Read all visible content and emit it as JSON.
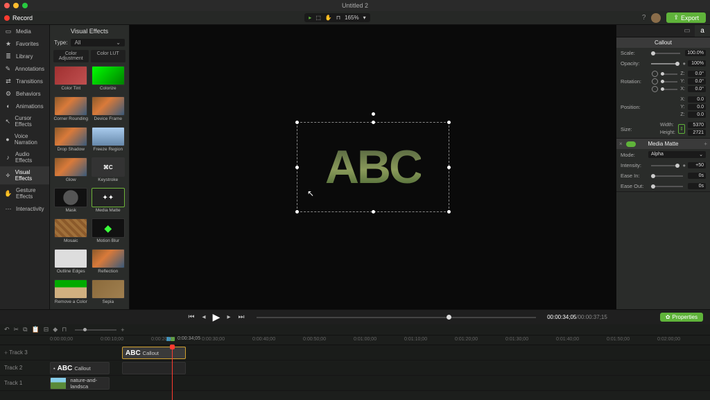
{
  "titlebar": {
    "title": "Untitled 2"
  },
  "toolbar": {
    "record": "Record",
    "zoom": "165%",
    "export": "Export"
  },
  "sidebar": {
    "items": [
      {
        "icon": "▭",
        "label": "Media"
      },
      {
        "icon": "★",
        "label": "Favorites"
      },
      {
        "icon": "≣",
        "label": "Library"
      },
      {
        "icon": "✎",
        "label": "Annotations"
      },
      {
        "icon": "⇄",
        "label": "Transitions"
      },
      {
        "icon": "⚙",
        "label": "Behaviors"
      },
      {
        "icon": "◐",
        "label": "Animations"
      },
      {
        "icon": "↖",
        "label": "Cursor Effects"
      },
      {
        "icon": "🎤",
        "label": "Voice Narration"
      },
      {
        "icon": "♪",
        "label": "Audio Effects"
      },
      {
        "icon": "✧",
        "label": "Visual Effects"
      },
      {
        "icon": "✋",
        "label": "Gesture Effects"
      },
      {
        "icon": "⋯",
        "label": "Interactivity"
      }
    ],
    "active_index": 10
  },
  "effects": {
    "title": "Visual Effects",
    "type_label": "Type:",
    "type_value": "All",
    "filters": [
      "Color Adjustment",
      "Color LUT"
    ],
    "items": [
      "Color Tint",
      "Colorize",
      "Corner Rounding",
      "Device Frame",
      "Drop Shadow",
      "Freeze Region",
      "Glow",
      "Keystroke",
      "Mask",
      "Media Matte",
      "Mosaic",
      "Motion Blur",
      "Outline Edges",
      "Reflection",
      "Remove a Color",
      "Sepia"
    ],
    "selected_index": 9
  },
  "canvas": {
    "text": "ABC"
  },
  "properties": {
    "section1": "Callout",
    "scale_label": "Scale:",
    "scale_value": "100.0%",
    "opacity_label": "Opacity:",
    "opacity_value": "100%",
    "rotation_label": "Rotation:",
    "rot_z": "Z:",
    "rot_z_val": "0.0°",
    "rot_y": "Y:",
    "rot_y_val": "0.0°",
    "rot_x": "X:",
    "rot_x_val": "0.0°",
    "position_label": "Position:",
    "pos_x": "X:",
    "pos_x_val": "0.0",
    "pos_y": "Y:",
    "pos_y_val": "0.0",
    "pos_z": "Z:",
    "pos_z_val": "0.0",
    "size_label": "Size:",
    "size_w": "Width:",
    "size_w_val": "5370",
    "size_h": "Height:",
    "size_h_val": "2721",
    "section2": "Media Matte",
    "mode_label": "Mode:",
    "mode_value": "Alpha",
    "intensity_label": "Intensity:",
    "intensity_value": "+50",
    "easein_label": "Ease In:",
    "easein_value": "0s",
    "easeout_label": "Ease Out:",
    "easeout_value": "0s"
  },
  "playback": {
    "time_current": "00:00:34;05",
    "time_total": "/00:00:37;15",
    "props_btn": "Properties"
  },
  "timeline": {
    "playhead_time": "0:00:34;05",
    "ruler": [
      "0:00:00;00",
      "0:00:10;00",
      "0:00:20;00",
      "0:00:30;00",
      "0:00:40;00",
      "0:00:50;00",
      "0:01:00;00",
      "0:01:10;00",
      "0:01:20;00",
      "0:01:30;00",
      "0:01:40;00",
      "0:01:50;00",
      "0:02:00;00"
    ],
    "tracks": [
      {
        "name": "Track 3"
      },
      {
        "name": "Track 2"
      },
      {
        "name": "Track 1"
      }
    ],
    "clip_callout_text": "ABC",
    "clip_callout_label": "Callout",
    "clip_media_label": "nature-and-landsca"
  }
}
